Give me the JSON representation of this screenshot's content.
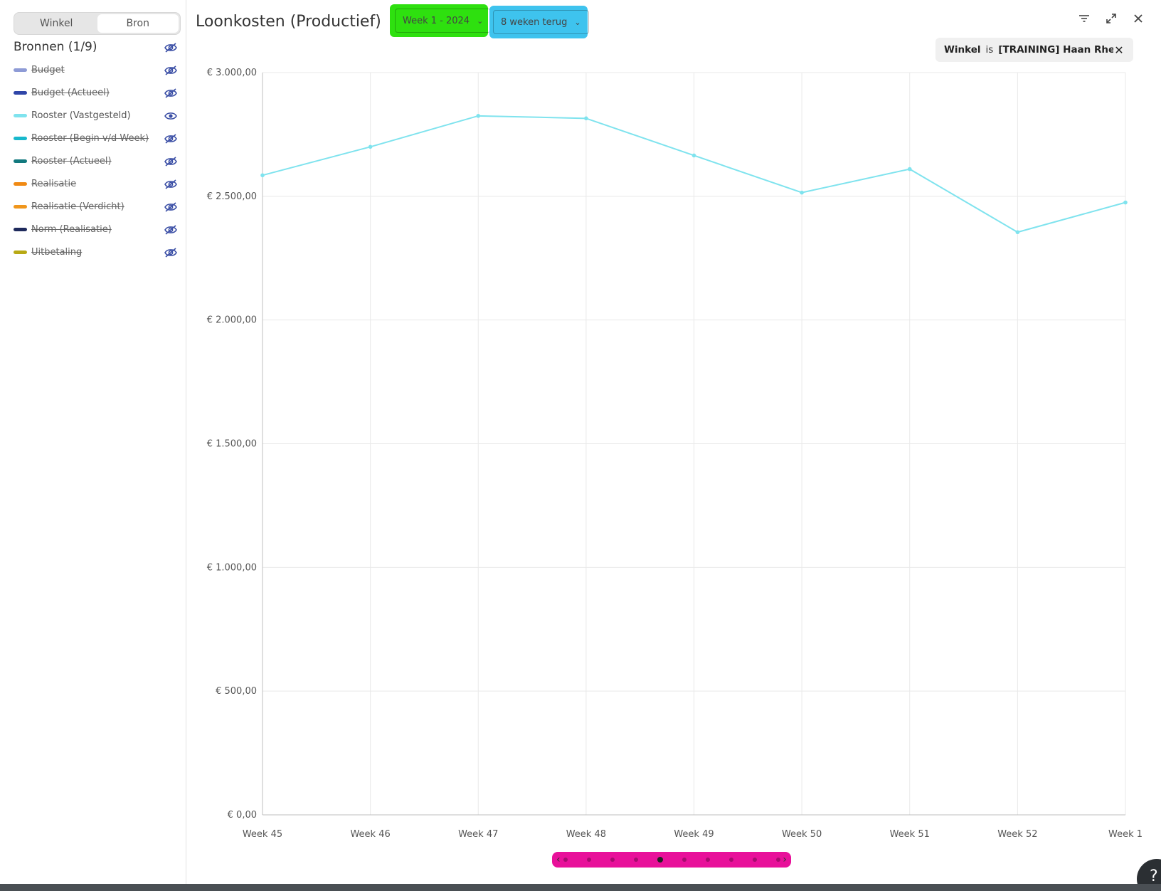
{
  "sidebar": {
    "segment": {
      "left_label": "Winkel",
      "right_label": "Bron"
    },
    "sources_title": "Bronnen (1/9)",
    "sources": [
      {
        "label": "Budget",
        "color": "#8e9bd6",
        "visible": false
      },
      {
        "label": "Budget (Actueel)",
        "color": "#2f45a8",
        "visible": false
      },
      {
        "label": "Rooster (Vastgesteld)",
        "color": "#7fe3ee",
        "visible": true
      },
      {
        "label": "Rooster (Begin v/d Week)",
        "color": "#18b8cc",
        "visible": false
      },
      {
        "label": "Rooster (Actueel)",
        "color": "#12797e",
        "visible": false
      },
      {
        "label": "Realisatie",
        "color": "#f08a14",
        "visible": false
      },
      {
        "label": "Realisatie (Verdicht)",
        "color": "#f0961c",
        "visible": false
      },
      {
        "label": "Norm (Realisatie)",
        "color": "#1e2a5c",
        "visible": false
      },
      {
        "label": "Uitbetaling",
        "color": "#b8a914",
        "visible": false
      }
    ]
  },
  "header": {
    "title": "Loonkosten (Productief)",
    "week_select": "Week 1 - 2024",
    "range_select": "8 weken terug"
  },
  "filter_chip": {
    "key": "Winkel",
    "operator": "is",
    "value": "[TRAINING] Haan Rhe..."
  },
  "help_label": "?",
  "colors": {
    "accent_icon": "#3a4ea5",
    "line": "#7fe3ee",
    "week_highlight": "#2ee00f",
    "range_highlight": "#3ec3ee",
    "pager_highlight": "#e8119a"
  },
  "pager": {
    "count": 10,
    "active_index": 4
  },
  "chart_data": {
    "type": "line",
    "categories": [
      "Week 45",
      "Week 46",
      "Week 47",
      "Week 48",
      "Week 49",
      "Week 50",
      "Week 51",
      "Week 52",
      "Week 1"
    ],
    "series": [
      {
        "name": "Rooster (Vastgesteld)",
        "values": [
          2585,
          2700,
          2825,
          2815,
          2665,
          2515,
          2610,
          2355,
          2475
        ]
      }
    ],
    "ylim": [
      0,
      3000
    ],
    "yticks": [
      0,
      500,
      1000,
      1500,
      2000,
      2500,
      3000
    ],
    "ytick_labels": [
      "€ 0,00",
      "€ 500,00",
      "€ 1.000,00",
      "€ 1.500,00",
      "€ 2.000,00",
      "€ 2.500,00",
      "€ 3.000,00"
    ],
    "grid": true,
    "title": "",
    "xlabel": "",
    "ylabel": ""
  }
}
